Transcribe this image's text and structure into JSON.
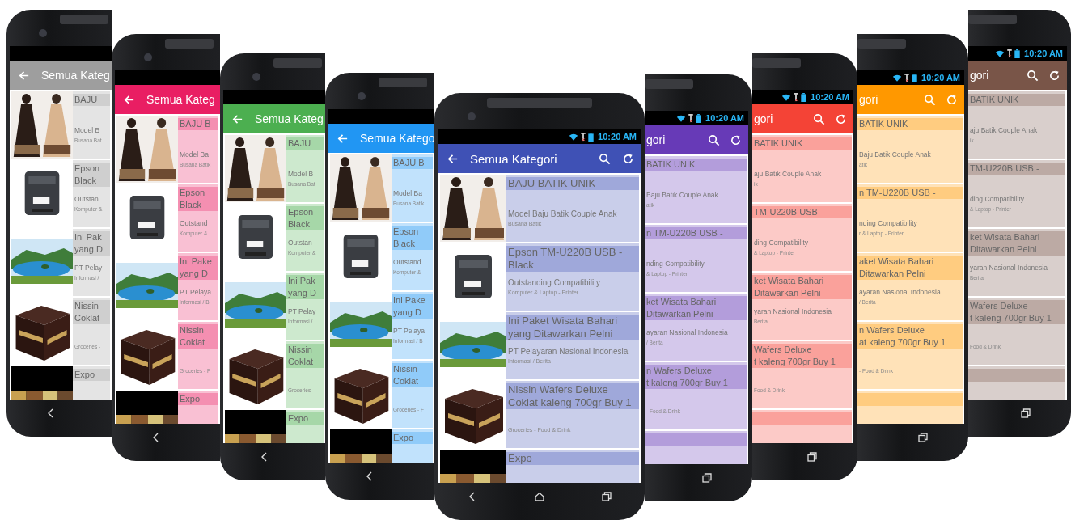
{
  "phones": [
    {
      "kind": "left",
      "color": "#9e9e9e",
      "title": "Semua Kateg",
      "items": [
        {
          "title_lines": [
            "BAJU"
          ],
          "subtitle": "Model B",
          "category": "Busana Bat"
        },
        {
          "title_lines": [
            "Epson",
            "Black"
          ],
          "subtitle": "Outstan",
          "category": "Komputer &"
        },
        {
          "title_lines": [
            "Ini Pak",
            "yang D"
          ],
          "subtitle": "PT Pelay",
          "category": "Informasi /"
        },
        {
          "title_lines": [
            "Nissin",
            "Coklat"
          ],
          "category": "Groceries -"
        },
        {
          "title_lines": [
            "Expo"
          ]
        }
      ]
    },
    {
      "kind": "left",
      "color": "#e91e63",
      "title": "Semua Kateg",
      "items": [
        {
          "title_lines": [
            "BAJU B"
          ],
          "subtitle": "Model Ba",
          "category": "Busana Batik"
        },
        {
          "title_lines": [
            "Epson",
            "Black"
          ],
          "subtitle": "Outstand",
          "category": "Komputer &"
        },
        {
          "title_lines": [
            "Ini Pake",
            "yang D"
          ],
          "subtitle": "PT Pelaya",
          "category": "Informasi / B"
        },
        {
          "title_lines": [
            "Nissin",
            "Coklat"
          ],
          "category": "Groceries - F"
        },
        {
          "title_lines": [
            "Expo"
          ]
        }
      ]
    },
    {
      "kind": "left",
      "color": "#4caf50",
      "title": "Semua Kateg",
      "items": [
        {
          "title_lines": [
            "BAJU"
          ],
          "subtitle": "Model B",
          "category": "Busana Bat"
        },
        {
          "title_lines": [
            "Epson",
            "Black"
          ],
          "subtitle": "Outstan",
          "category": "Komputer &"
        },
        {
          "title_lines": [
            "Ini Pak",
            "yang D"
          ],
          "subtitle": "PT Pelay",
          "category": "Informasi /"
        },
        {
          "title_lines": [
            "Nissin",
            "Coklat"
          ],
          "category": "Groceries -"
        },
        {
          "title_lines": [
            "Expo"
          ]
        }
      ]
    },
    {
      "kind": "left",
      "color": "#2196f3",
      "title": "Semua Katego",
      "items": [
        {
          "title_lines": [
            "BAJU B"
          ],
          "subtitle": "Model Ba",
          "category": "Busana Batik"
        },
        {
          "title_lines": [
            "Epson",
            "Black"
          ],
          "subtitle": "Outstand",
          "category": "Komputer &"
        },
        {
          "title_lines": [
            "Ini Pake",
            "yang D"
          ],
          "subtitle": "PT Pelaya",
          "category": "Informasi / B"
        },
        {
          "title_lines": [
            "Nissin",
            "Coklat"
          ],
          "category": "Groceries - F"
        },
        {
          "title_lines": [
            "Expo"
          ]
        }
      ]
    },
    {
      "kind": "center",
      "color": "#3f51b5",
      "status_time": "10:20 AM",
      "title": "Semua Kategori",
      "items": [
        {
          "title_lines": [
            "BAJU BATIK UNIK"
          ],
          "subtitle": "Model Baju Batik Couple Anak",
          "category": "Busana Batik"
        },
        {
          "title_lines": [
            "Epson TM-U220B USB -",
            "Black"
          ],
          "subtitle": "Outstanding Compatibility",
          "category": "Komputer & Laptop - Printer"
        },
        {
          "title_lines": [
            "Ini Paket Wisata Bahari",
            "yang Ditawarkan Pelni"
          ],
          "subtitle": "PT Pelayaran Nasional Indonesia",
          "category": "Informasi / Berita"
        },
        {
          "title_lines": [
            "Nissin Wafers Deluxe",
            "Coklat kaleng 700gr Buy 1"
          ],
          "category": "Groceries - Food & Drink"
        },
        {
          "title_lines": [
            "Expo"
          ]
        }
      ]
    },
    {
      "kind": "right",
      "color": "#673ab7",
      "status_time": "10:20 AM",
      "title": "gori",
      "items": [
        {
          "title_lines": [
            "BATIK UNIK"
          ],
          "subtitle": "Baju Batik Couple Anak",
          "category": "atik"
        },
        {
          "title_lines": [
            "n TM-U220B USB -"
          ],
          "subtitle": "nding Compatibility",
          "category": "& Laptop - Printer"
        },
        {
          "title_lines": [
            "ket Wisata Bahari",
            "Ditawarkan Pelni"
          ],
          "subtitle": "ayaran Nasional Indonesia",
          "category": "/ Berita"
        },
        {
          "title_lines": [
            "n Wafers Deluxe",
            "t kaleng 700gr Buy 1"
          ],
          "category": "- Food & Drink"
        }
      ]
    },
    {
      "kind": "right",
      "color": "#f44336",
      "status_time": "10:20 AM",
      "title": "gori",
      "items": [
        {
          "title_lines": [
            "BATIK UNIK"
          ],
          "subtitle": "aju Batik Couple Anak",
          "category": "ik"
        },
        {
          "title_lines": [
            "TM-U220B USB -"
          ],
          "subtitle": "ding Compatibility",
          "category": "& Laptop - Printer"
        },
        {
          "title_lines": [
            "ket Wisata Bahari",
            "Ditawarkan Pelni"
          ],
          "subtitle": "yaran Nasional Indonesia",
          "category": "Berita"
        },
        {
          "title_lines": [
            "Wafers Deluxe",
            "t kaleng 700gr Buy 1"
          ],
          "category": "Food & Drink"
        }
      ]
    },
    {
      "kind": "right",
      "color": "#ff9800",
      "status_time": "10:20 AM",
      "title": "gori",
      "items": [
        {
          "title_lines": [
            "BATIK UNIK"
          ],
          "subtitle": "Baju Batik Couple Anak",
          "category": "atik"
        },
        {
          "title_lines": [
            "n TM-U220B USB -"
          ],
          "subtitle": "nding Compatibility",
          "category": "r & Laptop - Printer"
        },
        {
          "title_lines": [
            "aket Wisata Bahari",
            "Ditawarkan Pelni"
          ],
          "subtitle": "ayaran Nasional Indonesia",
          "category": "/ Berita"
        },
        {
          "title_lines": [
            "n Wafers Deluxe",
            "at kaleng 700gr Buy 1"
          ],
          "category": "- Food & Drink"
        }
      ]
    },
    {
      "kind": "right",
      "color": "#795548",
      "status_time": "10:20 AM",
      "title": "gori",
      "items": [
        {
          "title_lines": [
            "BATIK UNIK"
          ],
          "subtitle": "aju Batik Couple Anak",
          "category": "ik"
        },
        {
          "title_lines": [
            "TM-U220B USB -"
          ],
          "subtitle": "ding Compatibility",
          "category": "& Laptop - Printer"
        },
        {
          "title_lines": [
            "ket Wisata Bahari",
            "Ditawarkan Pelni"
          ],
          "subtitle": "yaran Nasional Indonesia",
          "category": "Berita"
        },
        {
          "title_lines": [
            "Wafers Deluxe",
            "t kaleng 700gr Buy 1"
          ],
          "category": "Food & Drink"
        }
      ]
    }
  ]
}
